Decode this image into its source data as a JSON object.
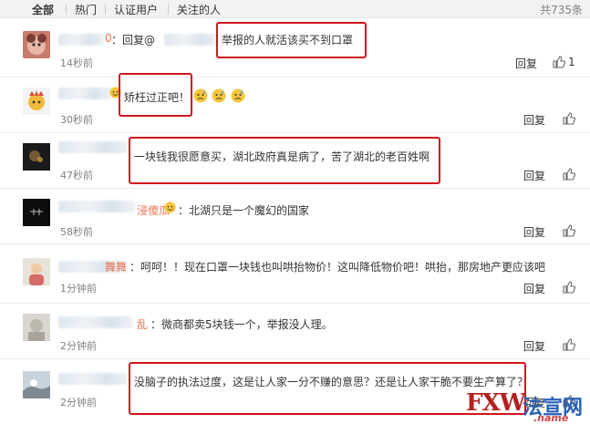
{
  "filter_bar": {
    "tabs": [
      "全部",
      "热门",
      "认证用户",
      "关注的人"
    ],
    "total": "共735条"
  },
  "comments": [
    {
      "name_tail": "0",
      "text_prefix": "：回复@",
      "text": "举报的人就活该买不到口罩",
      "time": "14秒前",
      "reply": "回复",
      "likes": "1"
    },
    {
      "name_tail": "",
      "text": "矫枉过正吧！",
      "time": "30秒前",
      "reply": "回复",
      "likes": ""
    },
    {
      "name_tail": "",
      "text": "一块钱我很愿意买，湖北政府真是病了，苦了湖北的老百姓啊",
      "time": "47秒前",
      "reply": "回复",
      "likes": ""
    },
    {
      "name_tail": "浸傻瓜",
      "text": "：北湖只是一个魔幻的国家",
      "time": "58秒前",
      "reply": "回复",
      "likes": ""
    },
    {
      "name_tail": "舞舞",
      "text": "：呵呵！！现在口罩一块钱也叫哄抬物价！这叫降低物价吧！哄抬，那房地产更应该吧",
      "time": "1分钟前",
      "reply": "回复",
      "likes": ""
    },
    {
      "name_tail": "乱",
      "text": "：微商都卖5块钱一个，举报没人理。",
      "time": "2分钟前",
      "reply": "回复",
      "likes": ""
    },
    {
      "name_tail": "",
      "text": "没脑子的执法过度，这是让人家一分不赚的意思？还是让人家干脆不要生产算了？",
      "time": "2分钟前",
      "reply": "回复",
      "likes": ""
    }
  ],
  "watermark": {
    "brand": "FXW",
    "cn": "法宣网",
    "domain": ".name"
  },
  "colors": {
    "highlight": "#d0141c",
    "link": "#eb7350",
    "bar": "#f2f2f5"
  },
  "icons": [
    "thumbs-up-icon",
    "sweat-emoji-icon",
    "smile-emoji-icon"
  ]
}
